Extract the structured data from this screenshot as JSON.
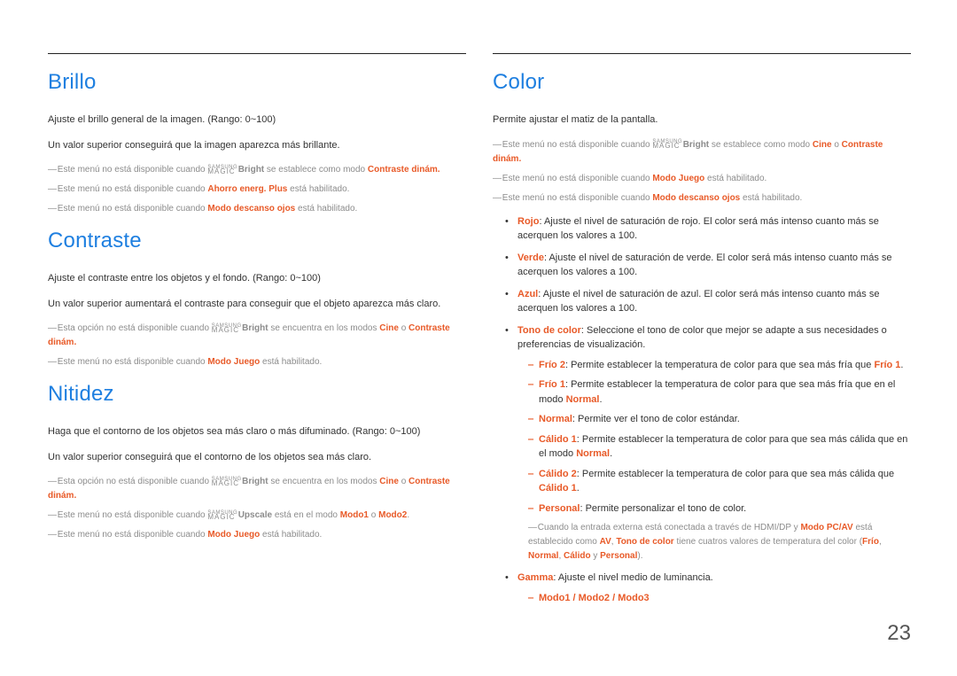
{
  "page_number": "23",
  "left": {
    "brillo": {
      "heading": "Brillo",
      "desc1": "Ajuste el brillo general de la imagen. (Rango: 0~100)",
      "desc2": "Un valor superior conseguirá que la imagen aparezca más brillante.",
      "note1_pre": "Este menú no está disponible cuando ",
      "note1_bright": "Bright",
      "note1_mid": " se establece como modo ",
      "note1_mode": "Contraste dinám.",
      "note2_pre": "Este menú no está disponible cuando ",
      "note2_mode": "Ahorro energ. Plus",
      "note2_post": " está habilitado.",
      "note3_pre": "Este menú no está disponible cuando ",
      "note3_mode": "Modo descanso ojos",
      "note3_post": " está habilitado."
    },
    "contraste": {
      "heading": "Contraste",
      "desc1": "Ajuste el contraste entre los objetos y el fondo. (Rango: 0~100)",
      "desc2": "Un valor superior aumentará el contraste para conseguir que el objeto aparezca más claro.",
      "note1_pre": "Esta opción no está disponible cuando ",
      "note1_bright": "Bright",
      "note1_mid": " se encuentra en los modos ",
      "note1_cine": "Cine",
      "note1_or": " o ",
      "note1_mode": "Contraste dinám.",
      "note2_pre": "Este menú no está disponible cuando ",
      "note2_mode": "Modo Juego",
      "note2_post": " está habilitado."
    },
    "nitidez": {
      "heading": "Nitidez",
      "desc1": "Haga que el contorno de los objetos sea más claro o más difuminado. (Rango: 0~100)",
      "desc2": "Un valor superior conseguirá que el contorno de los objetos sea más claro.",
      "note1_pre": "Esta opción no está disponible cuando ",
      "note1_bright": "Bright",
      "note1_mid": " se encuentra en los modos ",
      "note1_cine": "Cine",
      "note1_or": " o ",
      "note1_mode": "Contraste dinám.",
      "note2_pre": "Este menú no está disponible cuando ",
      "note2_upscale": "Upscale",
      "note2_mid": " está en el modo ",
      "note2_m1": "Modo1",
      "note2_or": " o ",
      "note2_m2": "Modo2",
      "note3_pre": "Este menú no está disponible cuando ",
      "note3_mode": "Modo Juego",
      "note3_post": " está habilitado."
    }
  },
  "right": {
    "color": {
      "heading": "Color",
      "desc1": "Permite ajustar el matiz de la pantalla.",
      "note1_pre": "Este menú no está disponible cuando ",
      "note1_bright": "Bright",
      "note1_mid": " se establece como modo ",
      "note1_cine": "Cine",
      "note1_or": " o ",
      "note1_mode": "Contraste dinám.",
      "note2_pre": "Este menú no está disponible cuando ",
      "note2_mode": "Modo Juego",
      "note2_post": " está habilitado.",
      "note3_pre": "Este menú no está disponible cuando ",
      "note3_mode": "Modo descanso ojos",
      "note3_post": " está habilitado.",
      "rojo_t": "Rojo",
      "rojo": ": Ajuste el nivel de saturación de rojo. El color será más intenso cuanto más se acerquen los valores a 100.",
      "verde_t": "Verde",
      "verde": ": Ajuste el nivel de saturación de verde. El color será más intenso cuanto más se acerquen los valores a 100.",
      "azul_t": "Azul",
      "azul": ": Ajuste el nivel de saturación de azul. El color será más intenso cuanto más se acerquen los valores a 100.",
      "tono_t": "Tono de color",
      "tono": ": Seleccione el tono de color que mejor se adapte a sus necesidades o preferencias de visualización.",
      "frio2_t": "Frío 2",
      "frio2_a": ": Permite establecer la temperatura de color para que sea más fría que ",
      "frio2_b": "Frío 1",
      "frio1_t": "Frío 1",
      "frio1_a": ": Permite establecer la temperatura de color para que sea más fría que en el modo ",
      "frio1_b": "Normal",
      "normal_t": "Normal",
      "normal": ": Permite ver el tono de color estándar.",
      "cal1_t": "Cálido 1",
      "cal1_a": ": Permite establecer la temperatura de color para que sea más cálida que en el modo ",
      "cal1_b": "Normal",
      "cal2_t": "Cálido 2",
      "cal2_a": ": Permite establecer la temperatura de color para que sea más cálida que ",
      "cal2_b": "Cálido 1",
      "pers_t": "Personal",
      "pers": ": Permite personalizar el tono de color.",
      "hdmi_pre": "Cuando la entrada externa está conectada a través de HDMI/DP y ",
      "hdmi_a": "Modo PC/AV",
      "hdmi_mid1": " está establecido como ",
      "hdmi_b": "AV",
      "hdmi_sep": ", ",
      "hdmi_c": "Tono de color",
      "hdmi_mid2": " tiene cuatros valores de temperatura del color (",
      "hdmi_v1": "Frío",
      "hdmi_c1": ", ",
      "hdmi_v2": "Normal",
      "hdmi_c2": ", ",
      "hdmi_v3": "Cálido",
      "hdmi_and": " y ",
      "hdmi_v4": "Personal",
      "hdmi_end": ").",
      "gamma_t": "Gamma",
      "gamma": ": Ajuste el nivel medio de luminancia.",
      "modos": "Modo1 / Modo2 / Modo3"
    }
  }
}
